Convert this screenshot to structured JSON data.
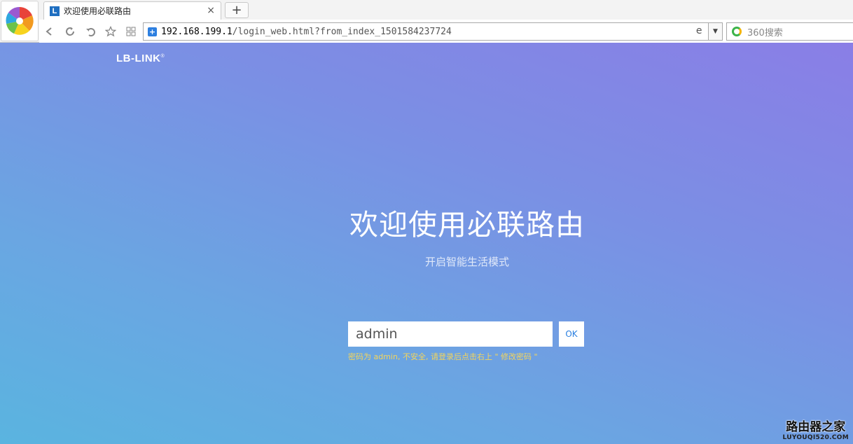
{
  "browser": {
    "tab_title": "欢迎使用必联路由",
    "tab_close": "×",
    "new_tab": "+",
    "url_host": "192.168.199.1",
    "url_path": "/login_web.html?from_index_1501584237724",
    "search_placeholder": "360搜索"
  },
  "page": {
    "brand": "LB-LINK",
    "brand_mark": "®",
    "title": "欢迎使用必联路由",
    "subtitle": "开启智能生活模式",
    "password_value": "admin",
    "ok_label": "OK",
    "hint": "密码为 admin, 不安全, 请登录后点击右上 \" 修改密码 \""
  },
  "watermark": {
    "name": "路由器之家",
    "site": "LUYOUQI520.COM"
  },
  "colors": {
    "accent": "#2a7fe0",
    "hint": "#f3d45c"
  }
}
